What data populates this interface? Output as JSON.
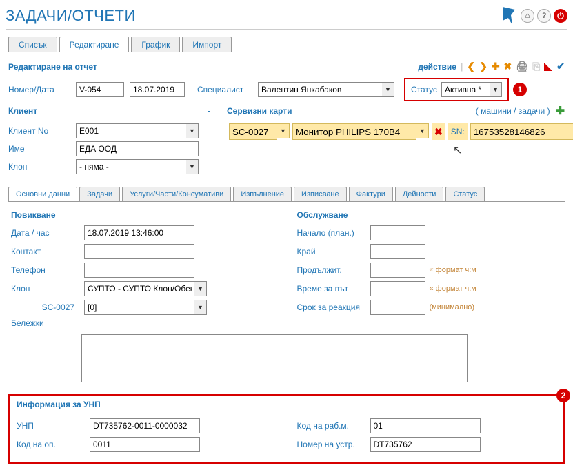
{
  "header": {
    "title": "ЗАДАЧИ/ОТЧЕТИ",
    "home_tip": "⌂",
    "help_tip": "?",
    "power_tip": "⏻"
  },
  "top_tabs": [
    "Списък",
    "Редактиране",
    "График",
    "Импорт"
  ],
  "top_tabs_active": 1,
  "section_title": "Редактиране на отчет",
  "toolbar": {
    "action": "действие"
  },
  "fields": {
    "number_date_label": "Номер/Дата",
    "number_value": "V-054",
    "date_value": "18.07.2019",
    "specialist_label": "Специалист",
    "specialist_value": "Валентин Янкабаков",
    "status_label": "Статус",
    "status_value": "Активна *",
    "client_label": "Клиент",
    "client_dash": "-",
    "service_cards_label": "Сервизни карти",
    "machines_tasks_link": "( машини / задачи )",
    "client_no_label": "Клиент No",
    "client_no_value": "E001",
    "name_label": "Име",
    "name_value": "ЕДА ООД",
    "branch_label": "Клон",
    "branch_value": "- няма -",
    "svc_code": "SC-0027",
    "svc_item": "Монитор PHILIPS 170B4",
    "sn_label": "SN:",
    "sn_value": "16753528146826"
  },
  "subtabs": [
    "Основни данни",
    "Задачи",
    "Услуги/Части/Консумативи",
    "Изпълнение",
    "Изписване",
    "Фактури",
    "Дейности",
    "Статус"
  ],
  "subtabs_active": 0,
  "call": {
    "title": "Повикване",
    "datetime_label": "Дата / час",
    "datetime_value": "18.07.2019 13:46:00",
    "contact_label": "Контакт",
    "contact_value": "",
    "phone_label": "Телефон",
    "phone_value": "",
    "branch_label": "Клон",
    "branch_value": "СУПТО - СУПТО Клон/Обект *",
    "sc_label": "SC-0027",
    "sc_value": "[0]",
    "notes_label": "Бележки"
  },
  "service": {
    "title": "Обслужване",
    "start_label": "Начало (план.)",
    "start_value": "",
    "end_label": "Край",
    "end_value": "",
    "duration_label": "Продължит.",
    "duration_value": "",
    "travel_label": "Време за път",
    "travel_value": "",
    "reaction_label": "Срок за реакция",
    "reaction_value": "",
    "hint_format": "« формат ч:м",
    "hint_min": "(минимално)"
  },
  "unp": {
    "title": "Информация за УНП",
    "unp_label": "УНП",
    "unp_value": "DT735762-0011-0000032",
    "op_code_label": "Код на оп.",
    "op_code_value": "0011",
    "work_code_label": "Код на раб.м.",
    "work_code_value": "01",
    "dev_no_label": "Номер на устр.",
    "dev_no_value": "DT735762"
  },
  "badges": {
    "one": "1",
    "two": "2"
  }
}
